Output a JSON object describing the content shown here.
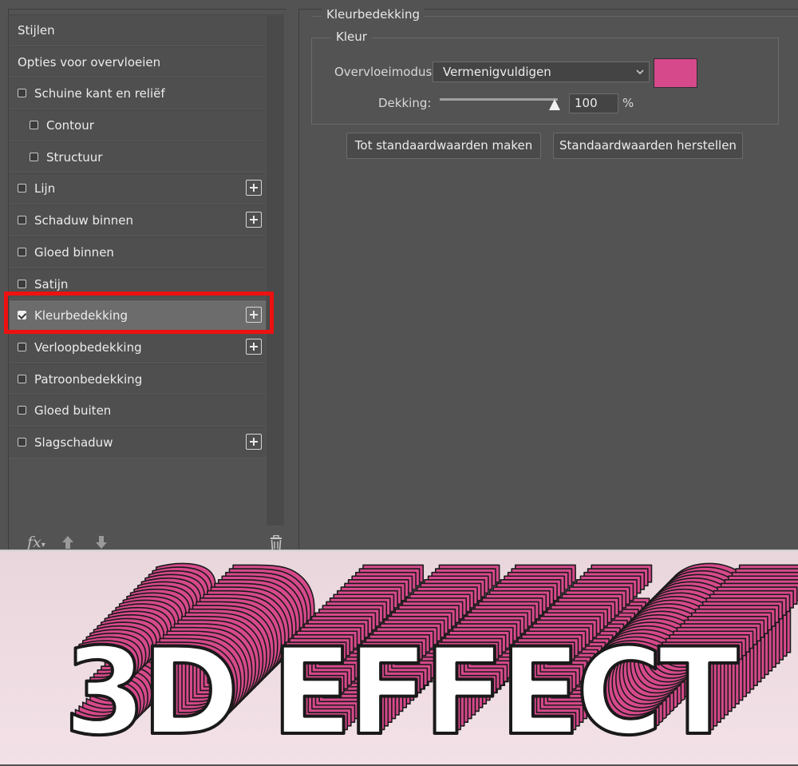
{
  "styles_panel": {
    "items": [
      {
        "label": "Stijlen",
        "checkbox": false,
        "indent": 0,
        "plus": false,
        "selected": false
      },
      {
        "label": "Opties voor overvloeien",
        "checkbox": false,
        "indent": 0,
        "plus": false,
        "selected": false
      },
      {
        "label": "Schuine kant en reliëf",
        "checkbox": true,
        "checked": false,
        "indent": 0,
        "plus": false,
        "selected": false
      },
      {
        "label": "Contour",
        "checkbox": true,
        "checked": false,
        "indent": 1,
        "plus": false,
        "selected": false
      },
      {
        "label": "Structuur",
        "checkbox": true,
        "checked": false,
        "indent": 1,
        "plus": false,
        "selected": false
      },
      {
        "label": "Lijn",
        "checkbox": true,
        "checked": false,
        "indent": 0,
        "plus": true,
        "selected": false
      },
      {
        "label": "Schaduw binnen",
        "checkbox": true,
        "checked": false,
        "indent": 0,
        "plus": true,
        "selected": false
      },
      {
        "label": "Gloed binnen",
        "checkbox": true,
        "checked": false,
        "indent": 0,
        "plus": false,
        "selected": false
      },
      {
        "label": "Satijn",
        "checkbox": true,
        "checked": false,
        "indent": 0,
        "plus": false,
        "selected": false
      },
      {
        "label": "Kleurbedekking",
        "checkbox": true,
        "checked": true,
        "indent": 0,
        "plus": true,
        "selected": true
      },
      {
        "label": "Verloopbedekking",
        "checkbox": true,
        "checked": false,
        "indent": 0,
        "plus": true,
        "selected": false
      },
      {
        "label": "Patroonbedekking",
        "checkbox": true,
        "checked": false,
        "indent": 0,
        "plus": false,
        "selected": false
      },
      {
        "label": "Gloed buiten",
        "checkbox": true,
        "checked": false,
        "indent": 0,
        "plus": false,
        "selected": false
      },
      {
        "label": "Slagschaduw",
        "checkbox": true,
        "checked": false,
        "indent": 0,
        "plus": true,
        "selected": false
      }
    ],
    "bottom_icons": [
      "fx-icon",
      "arrow-up-icon",
      "arrow-down-icon",
      "trash-icon"
    ],
    "fx_label": "fx"
  },
  "settings": {
    "group_title": "Kleurbedekking",
    "subgroup_title": "Kleur",
    "blend_label": "Overvloeimodus:",
    "blend_value": "Vermenigvuldigen",
    "opacity_label": "Dekking:",
    "opacity_value": "100",
    "opacity_level": 1.0,
    "percent": "%",
    "color_swatch": "#d6498b",
    "btn_make_default": "Tot standaardwaarden maken",
    "btn_reset_default": "Standaardwaarden herstellen"
  },
  "preview": {
    "text": "3D EFFECT",
    "extrusion_color": "#d6498b",
    "face_color": "#ffffff"
  },
  "highlight_color": "#ee1111"
}
